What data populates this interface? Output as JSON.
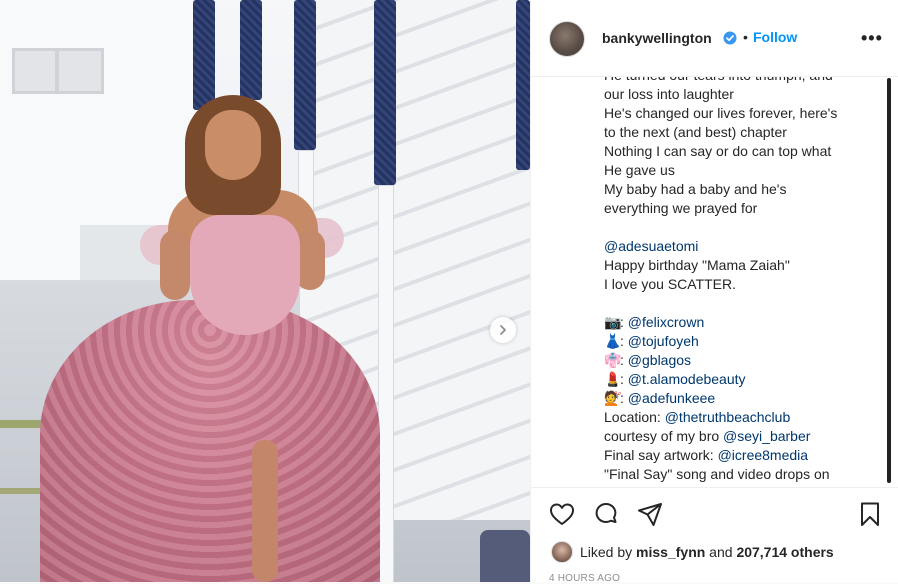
{
  "post": {
    "username": "bankywellington",
    "dot": "•",
    "follow_label": "Follow",
    "more_label": "•••"
  },
  "caption_lines": [
    {
      "text": "He turned our tears into triumph, and"
    },
    {
      "text": "our loss into laughter"
    },
    {
      "text": "He's changed our lives forever, here's"
    },
    {
      "text": "to the next (and best) chapter"
    },
    {
      "text": "Nothing I can say or do can top what"
    },
    {
      "text": "He gave us"
    },
    {
      "text": "My baby had a baby and he's"
    },
    {
      "text": "everything we prayed for"
    },
    {
      "text": ""
    },
    {
      "text": "@adesuaetomi",
      "mention": true
    },
    {
      "text": "Happy birthday \"Mama Zaiah\""
    },
    {
      "text": "I love you SCATTER."
    },
    {
      "text": ""
    },
    {
      "emoji": "📷",
      "prefix": ": ",
      "text": "@felixcrown",
      "mention": true
    },
    {
      "emoji": "👗",
      "prefix": ": ",
      "text": "@tojufoyeh",
      "mention": true
    },
    {
      "emoji": "👘",
      "prefix": ": ",
      "text": "@gblagos",
      "mention": true
    },
    {
      "emoji": "💄",
      "prefix": ": ",
      "text": "@t.alamodebeauty",
      "mention": true
    },
    {
      "emoji": "💇",
      "prefix": ": ",
      "text": "@adefunkeee",
      "mention": true
    },
    {
      "prefix": "Location: ",
      "text": "@thetruthbeachclub",
      "mention": true
    },
    {
      "prefix": "courtesy of my bro ",
      "text": "@seyi_barber",
      "mention": true
    },
    {
      "prefix": "Final say artwork: ",
      "text": "@icree8media",
      "mention": true
    },
    {
      "text": "\"Final Say\" song and video drops on"
    }
  ],
  "likes": {
    "prefix": "Liked by ",
    "user": "miss_fynn",
    "middle": " and ",
    "count": "207,714 others"
  },
  "timestamp": "4 HOURS AGO",
  "colors": {
    "accent": "#0095f6",
    "mention": "#00376b",
    "text": "#262626",
    "gown": "#c77388"
  },
  "icons": [
    "verified-badge-icon",
    "more-options-icon",
    "heart-icon",
    "comment-icon",
    "share-icon",
    "bookmark-icon",
    "next-arrow-icon"
  ]
}
